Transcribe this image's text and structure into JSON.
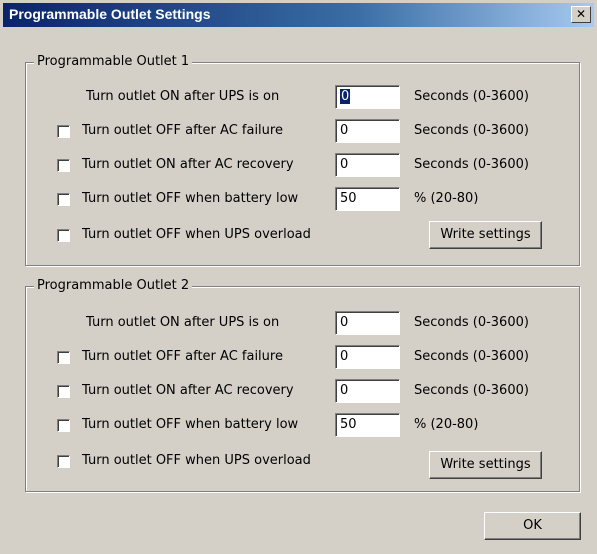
{
  "window": {
    "title": "Programmable Outlet Settings",
    "close_glyph": "✕"
  },
  "groups": [
    {
      "legend": "Programmable Outlet 1",
      "rows": [
        {
          "label": "Turn outlet ON after UPS is on",
          "value": "0",
          "units": "Seconds (0-3600)",
          "has_checkbox": false,
          "checked": false,
          "selected": true
        },
        {
          "label": "Turn outlet OFF after AC failure",
          "value": "0",
          "units": "Seconds (0-3600)",
          "has_checkbox": true,
          "checked": false
        },
        {
          "label": "Turn outlet ON after AC recovery",
          "value": "0",
          "units": "Seconds (0-3600)",
          "has_checkbox": true,
          "checked": false
        },
        {
          "label": "Turn outlet OFF when battery low",
          "value": "50",
          "units": "% (20-80)",
          "has_checkbox": true,
          "checked": false
        },
        {
          "label": "Turn outlet OFF when UPS overload",
          "has_checkbox": true,
          "checked": false
        }
      ],
      "write_label": "Write settings"
    },
    {
      "legend": "Programmable Outlet 2",
      "rows": [
        {
          "label": "Turn outlet ON after UPS is on",
          "value": "0",
          "units": "Seconds (0-3600)",
          "has_checkbox": false,
          "checked": false
        },
        {
          "label": "Turn outlet OFF after AC failure",
          "value": "0",
          "units": "Seconds (0-3600)",
          "has_checkbox": true,
          "checked": false
        },
        {
          "label": "Turn outlet ON after AC recovery",
          "value": "0",
          "units": "Seconds (0-3600)",
          "has_checkbox": true,
          "checked": false
        },
        {
          "label": "Turn outlet OFF when battery low",
          "value": "50",
          "units": "% (20-80)",
          "has_checkbox": true,
          "checked": false
        },
        {
          "label": "Turn outlet OFF when UPS overload",
          "has_checkbox": true,
          "checked": false
        }
      ],
      "write_label": "Write settings"
    }
  ],
  "ok_label": "OK",
  "colors": {
    "titlebar_start": "#0a246a",
    "titlebar_end": "#a6caf0",
    "face": "#d4d0c8"
  }
}
